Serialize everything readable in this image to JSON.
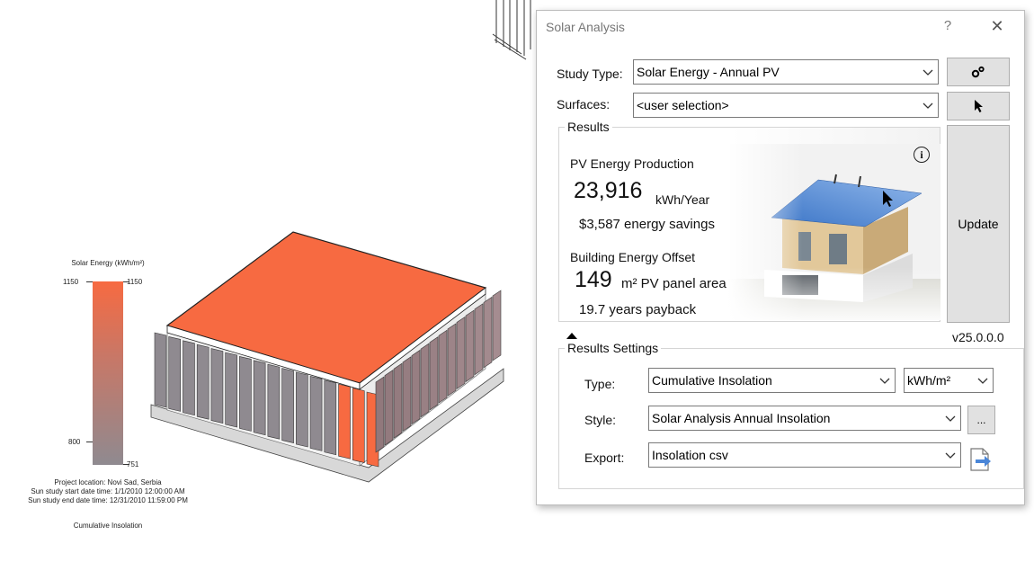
{
  "legend": {
    "title": "Solar Energy (kWh/m²)",
    "top_left": "1150",
    "top_right": "1150",
    "bottom_left": "800",
    "bottom_right": "751"
  },
  "project_info": {
    "location": "Project location: Novi Sad, Serbia",
    "start": "Sun study start date time: 1/1/2010 12:00:00 AM",
    "end": "Sun study end date time: 12/31/2010 11:59:00 PM"
  },
  "result_type_caption": "Cumulative Insolation",
  "dialog": {
    "title": "Solar Analysis",
    "help": "?",
    "close": "✕",
    "study_type_label": "Study Type:",
    "study_type_value": "Solar Energy - Annual PV",
    "surfaces_label": "Surfaces:",
    "surfaces_value": "<user selection>",
    "settings_icon": "gears-icon",
    "pick_icon": "cursor-icon",
    "results_group": "Results",
    "pv_heading": "PV Energy Production",
    "pv_value": "23,916",
    "pv_unit": "kWh/Year",
    "savings": "$3,587 energy savings",
    "offset_heading": "Building Energy Offset",
    "panel_value": "149",
    "panel_unit": "m² PV panel area",
    "payback": "19.7 years payback",
    "info_icon": "i",
    "update_button": "Update",
    "version": "v25.0.0.0",
    "settings_group": "Results Settings",
    "type_label": "Type:",
    "type_value": "Cumulative Insolation",
    "unit_value": "kWh/m²",
    "style_label": "Style:",
    "style_value": "Solar Analysis Annual Insolation",
    "style_more": "...",
    "export_label": "Export:",
    "export_value": "Insolation csv"
  },
  "colors": {
    "roof": "#f76a41",
    "fin_gray": "#8f8a90",
    "accent_blue": "#4a86d8"
  }
}
